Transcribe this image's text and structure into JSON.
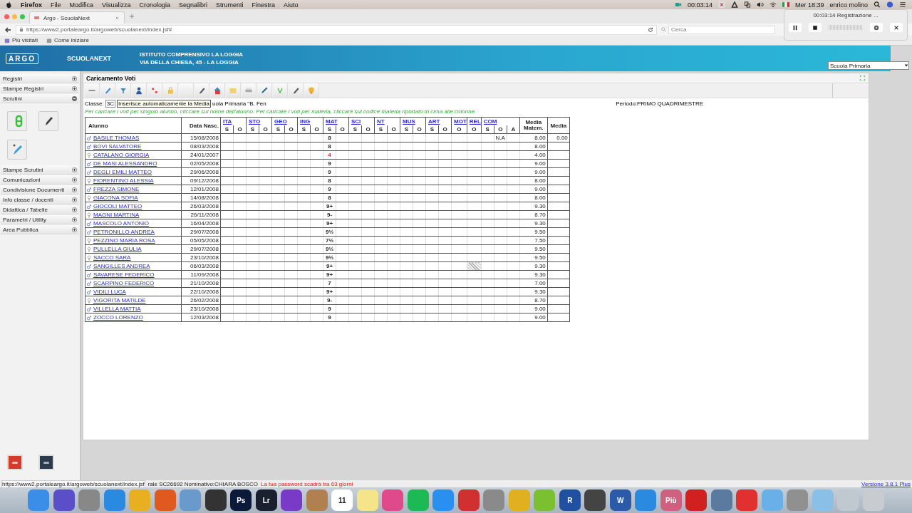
{
  "menubar": {
    "app": "Firefox",
    "items": [
      "File",
      "Modifica",
      "Visualizza",
      "Cronologia",
      "Segnalibri",
      "Strumenti",
      "Finestra",
      "Aiuto"
    ],
    "recording_time": "00:03:14",
    "clock": "Mer 18:39",
    "user": "enrico molino"
  },
  "recorder": {
    "title": "00:03:14 Registrazione ..."
  },
  "browser": {
    "tab": "Argo - ScuolaNext",
    "url": "https://www2.portaleargo.it/argoweb/scuolanext/index.jsf#",
    "search": {
      "placeholder": "Cerca"
    },
    "bookmarks": [
      "Più visitati",
      "Come iniziare"
    ]
  },
  "header": {
    "logo": "ARGO",
    "product": "SCUOLANEXT",
    "institute": "ISTITUTO COMPRENSIVO LA LOGGIA",
    "address": "VIA DELLA CHIESA, 45 - LA LOGGIA",
    "school_select": "Scuola Primaria"
  },
  "sidebar": {
    "sections": [
      {
        "label": "Registri",
        "expanded": false
      },
      {
        "label": "Stampe Registri",
        "expanded": false
      },
      {
        "label": "Scrutini",
        "expanded": true
      },
      {
        "label": "Stampe Scrutini",
        "expanded": false
      },
      {
        "label": "Comunicazioni",
        "expanded": false
      },
      {
        "label": "Condivisione Documenti",
        "expanded": false
      },
      {
        "label": "Info classe / docenti",
        "expanded": false
      },
      {
        "label": "Didattica / Tabelle",
        "expanded": false
      },
      {
        "label": "Parametri / Utility",
        "expanded": false
      },
      {
        "label": "Area Pubblica",
        "expanded": false
      }
    ]
  },
  "panel": {
    "title": "Caricamento Voti",
    "class_label": "Classe:",
    "class_value": "3C",
    "tooltip": "Inserisce automaticamente la Media",
    "class_desc": "uola Primaria \"B. Fen",
    "hint": "Per caricare i voti per singolo alunno, cliccare sul nome dell'alunno. Per caricare i voti per materia, cliccare sul codice materia riportato in cima alle colonne.",
    "period": "Periodo:PRIMO QUADRIMESTRE"
  },
  "table": {
    "columns": {
      "student": "Alunno",
      "birth": "Data Nasc.",
      "subjects": [
        {
          "code": "ITA",
          "subs": [
            "S",
            "O"
          ]
        },
        {
          "code": "STO",
          "subs": [
            "S",
            "O"
          ]
        },
        {
          "code": "GEO",
          "subs": [
            "S",
            "O"
          ]
        },
        {
          "code": "ING",
          "subs": [
            "S",
            "O"
          ]
        },
        {
          "code": "MAT",
          "subs": [
            "S",
            "O"
          ]
        },
        {
          "code": "SCI",
          "subs": [
            "S",
            "O"
          ]
        },
        {
          "code": "NT",
          "subs": [
            "S",
            "O"
          ]
        },
        {
          "code": "MUS",
          "subs": [
            "S",
            "O"
          ]
        },
        {
          "code": "ART",
          "subs": [
            "S",
            "O"
          ]
        },
        {
          "code": "MOT",
          "subs": [
            "O"
          ]
        },
        {
          "code": "REL",
          "subs": [
            "O"
          ]
        },
        {
          "code": "COM",
          "subs": [
            "S",
            "O",
            "A"
          ]
        }
      ],
      "media_matem": "Media Matem.",
      "media": "Media"
    },
    "rows": [
      {
        "kind": "male",
        "name": "BASILE THOMAS",
        "birth": "15/08/2008",
        "mat": "8",
        "insufficient": false,
        "rel_hatched": false,
        "com_o": "N.A",
        "media_matem": "8.00",
        "media": "0.00"
      },
      {
        "kind": "male",
        "name": "BOVI SALVATORE",
        "birth": "08/03/2008",
        "mat": "8",
        "insufficient": false,
        "rel_hatched": false,
        "media_matem": "8.00"
      },
      {
        "kind": "female",
        "name": "CATALANO GIORGIA",
        "birth": "24/01/2007",
        "mat": "4",
        "insufficient": true,
        "rel_hatched": false,
        "media_matem": "4.00"
      },
      {
        "kind": "male",
        "name": "DE MASI ALESSANDRO",
        "birth": "02/05/2008",
        "mat": "9",
        "insufficient": false,
        "rel_hatched": false,
        "media_matem": "9.00"
      },
      {
        "kind": "male",
        "name": "DEGLI EMILI MATTEO",
        "birth": "29/06/2008",
        "mat": "9",
        "insufficient": false,
        "rel_hatched": false,
        "media_matem": "9.00"
      },
      {
        "kind": "female",
        "name": "FIORENTINO ALESSIA",
        "birth": "09/12/2008",
        "mat": "8",
        "insufficient": false,
        "rel_hatched": false,
        "media_matem": "8.00"
      },
      {
        "kind": "male",
        "name": "FREZZA SIMONE",
        "birth": "12/01/2008",
        "mat": "9",
        "insufficient": false,
        "rel_hatched": false,
        "media_matem": "9.00"
      },
      {
        "kind": "female",
        "name": "GIACONA SOFIA",
        "birth": "14/08/2008",
        "mat": "8",
        "insufficient": false,
        "rel_hatched": false,
        "media_matem": "8.00"
      },
      {
        "kind": "male",
        "name": "GIOCOLI MATTEO",
        "birth": "26/03/2008",
        "mat": "9+",
        "insufficient": false,
        "rel_hatched": false,
        "media_matem": "9.30"
      },
      {
        "kind": "female",
        "name": "MAGNI MARTINA",
        "birth": "26/11/2008",
        "mat": "9-",
        "insufficient": false,
        "rel_hatched": false,
        "media_matem": "8.70"
      },
      {
        "kind": "male",
        "name": "MASCOLO ANTONIO",
        "birth": "16/04/2008",
        "mat": "9+",
        "insufficient": false,
        "rel_hatched": false,
        "media_matem": "9.30"
      },
      {
        "kind": "male",
        "name": "PETRONILLO ANDREA",
        "birth": "29/07/2008",
        "mat": "9½",
        "insufficient": false,
        "rel_hatched": false,
        "media_matem": "9.50"
      },
      {
        "kind": "female",
        "name": "PEZZINO MARIA ROSA",
        "birth": "05/05/2008",
        "mat": "7½",
        "insufficient": false,
        "rel_hatched": false,
        "media_matem": "7.50"
      },
      {
        "kind": "female",
        "name": "PULLELLA GIULIA",
        "birth": "29/07/2008",
        "mat": "9½",
        "insufficient": false,
        "rel_hatched": false,
        "media_matem": "9.50"
      },
      {
        "kind": "female",
        "name": "SACCO SARA",
        "birth": "23/10/2008",
        "mat": "9½",
        "insufficient": false,
        "rel_hatched": false,
        "media_matem": "9.50"
      },
      {
        "kind": "male",
        "name": "SANGILLES ANDREA",
        "birth": "06/03/2008",
        "mat": "9+",
        "insufficient": false,
        "rel_hatched": true,
        "media_matem": "9.30"
      },
      {
        "kind": "male",
        "name": "SAVARESE FEDERICO",
        "birth": "11/09/2008",
        "mat": "9+",
        "insufficient": false,
        "rel_hatched": false,
        "media_matem": "9.30"
      },
      {
        "kind": "male",
        "name": "SCARPINO FEDERICO",
        "birth": "21/10/2008",
        "mat": "7",
        "insufficient": false,
        "rel_hatched": false,
        "media_matem": "7.00"
      },
      {
        "kind": "male",
        "name": "VIDILI LUCA",
        "birth": "22/10/2008",
        "mat": "9+",
        "insufficient": false,
        "rel_hatched": false,
        "media_matem": "9.30"
      },
      {
        "kind": "female",
        "name": "VIGORITA MATILDE",
        "birth": "26/02/2008",
        "mat": "9-",
        "insufficient": false,
        "rel_hatched": false,
        "media_matem": "8.70"
      },
      {
        "kind": "male",
        "name": "VILLELLA MATTIA",
        "birth": "23/10/2008",
        "mat": "9",
        "insufficient": false,
        "rel_hatched": false,
        "media_matem": "9.00"
      },
      {
        "kind": "male",
        "name": "ZOCCO LORENZO",
        "birth": "12/03/2008",
        "mat": "9",
        "insufficient": false,
        "rel_hatched": false,
        "media_matem": "9.00"
      }
    ]
  },
  "status_bar": {
    "url": "https://www2.portaleargo.it/argoweb/scuolanext/index.jsf",
    "user": "rale SC26692 Nominativo:CHIARA BOSCO",
    "warning": "La tua password scadrà tra 63 giorni",
    "version": "Versione 3.8.1 Plus"
  },
  "dock": {
    "labels": [
      "Ps",
      "Lr",
      "11",
      "R",
      "W",
      "Più"
    ]
  }
}
